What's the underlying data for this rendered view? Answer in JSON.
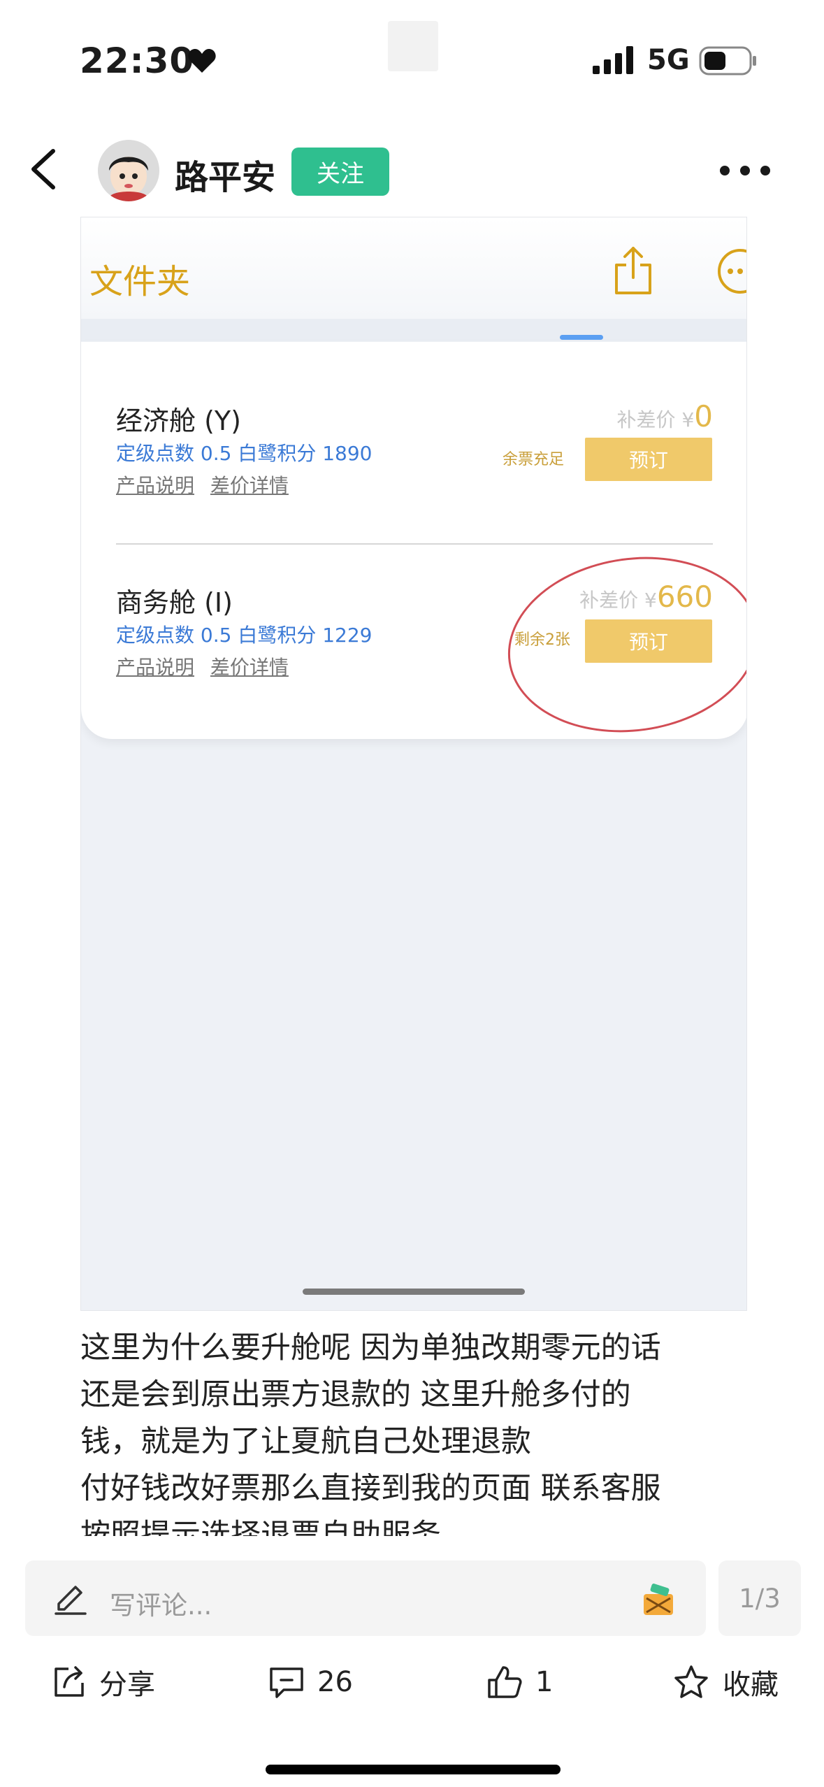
{
  "status_bar": {
    "time": "22:30",
    "network": "5G"
  },
  "post": {
    "author": "路平安",
    "follow_label": "关注",
    "body_lines": [
      "这里为什么要升舱呢 因为单独改期零元的话",
      "还是会到原出票方退款的 这里升舱多付的",
      "钱，就是为了让夏航自己处理退款",
      "付好钱改好票那么直接到我的页面 联系客服",
      "按照提示选择退票自助服务"
    ]
  },
  "screenshot": {
    "folder_label": "文件夹",
    "cabins": [
      {
        "name": "经济舱 (Y)",
        "meta": "定级点数 0.5   白鹭积分 1890",
        "link_product": "产品说明",
        "link_diff": "差价详情",
        "price_label": "补差价 ¥",
        "price_value": "0",
        "availability": "余票充足",
        "book_label": "预订"
      },
      {
        "name": "商务舱 (I)",
        "meta": "定级点数 0.5   白鹭积分 1229",
        "link_product": "产品说明",
        "link_diff": "差价详情",
        "price_label": "补差价 ¥",
        "price_value": "660",
        "availability": "剩余2张",
        "book_label": "预订"
      }
    ]
  },
  "comment_bar": {
    "placeholder": "写评论...",
    "page_indicator": "1/3"
  },
  "actions": {
    "share_label": "分享",
    "comment_count": "26",
    "like_count": "1",
    "favorite_label": "收藏"
  },
  "colors": {
    "follow_bg": "#2fbf8f",
    "accent_gold": "#d8a21a",
    "book_button": "#f0c96a",
    "meta_blue": "#3b7ad6",
    "annotation_red": "#d24d55"
  },
  "icons": [
    "heart-icon",
    "signal-icon",
    "battery-icon",
    "back-arrow-icon",
    "more-icon",
    "share-icon",
    "pencil-icon",
    "emoji-icon",
    "comment-icon",
    "thumbs-up-icon",
    "star-icon"
  ]
}
